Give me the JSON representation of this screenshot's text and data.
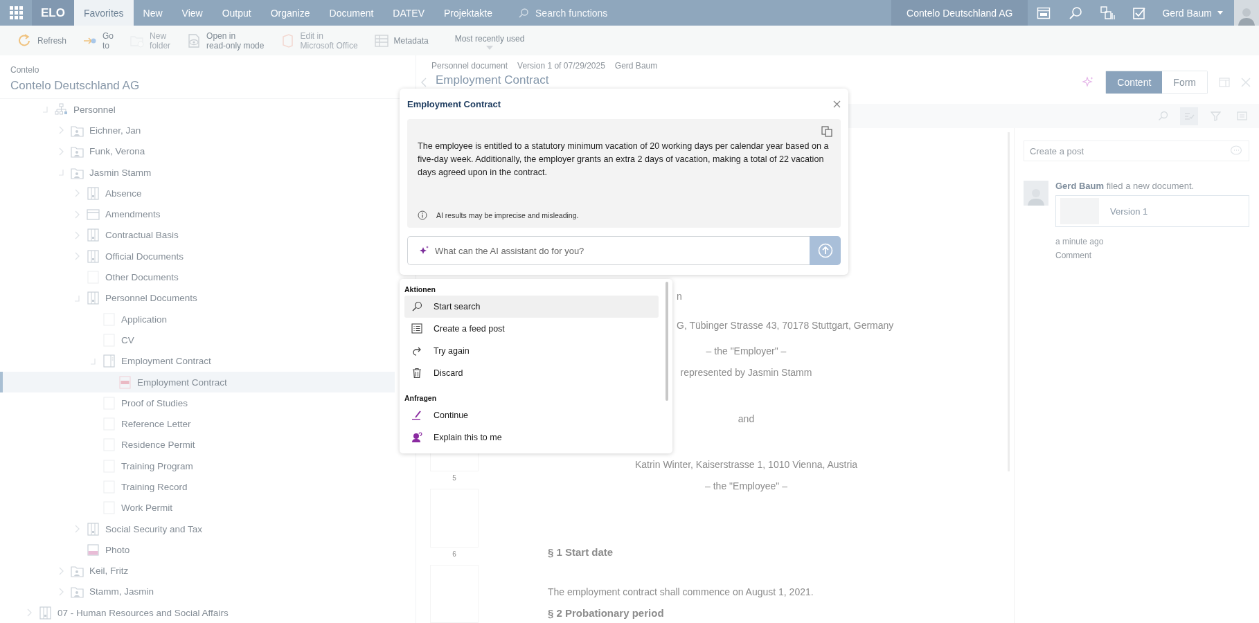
{
  "topbar": {
    "logo": "ELO",
    "tabs": [
      {
        "label": "Favorites",
        "selected": true
      },
      {
        "label": "New",
        "selected": false
      },
      {
        "label": "View",
        "selected": false
      },
      {
        "label": "Output",
        "selected": false
      },
      {
        "label": "Organize",
        "selected": false
      },
      {
        "label": "Document",
        "selected": false
      },
      {
        "label": "DATEV",
        "selected": false
      },
      {
        "label": "Projektakte",
        "selected": false
      }
    ],
    "search": {
      "placeholder": "Search functions"
    },
    "company": "Contelo Deutschland AG",
    "user": "Gerd Baum"
  },
  "toolbar": {
    "buttons": [
      {
        "label": "Refresh",
        "disabled": false
      },
      {
        "label": "Go\nto",
        "disabled": false
      },
      {
        "label": "New\nfolder",
        "disabled": true
      },
      {
        "label": "Open in\nread-only mode",
        "disabled": false
      },
      {
        "label": "Edit in\nMicrosoft Office",
        "disabled": true
      },
      {
        "label": "Metadata",
        "disabled": false
      }
    ],
    "dropdown": "Most recently used"
  },
  "navigation": {
    "breadcrumb": "Contelo",
    "title": "Contelo Deutschland AG",
    "tree": [
      {
        "children": [
          {
            "label": "Personnel",
            "kind": "org",
            "expanded": true,
            "selected": false,
            "children": [
              {
                "label": "Eichner, Jan",
                "kind": "person",
                "expanded": false,
                "selected": false
              },
              {
                "label": "Funk, Verona",
                "kind": "person",
                "expanded": false,
                "selected": false
              },
              {
                "label": "Jasmin Stamm",
                "kind": "person",
                "expanded": true,
                "selected": false,
                "children": [
                  {
                    "label": "Absence",
                    "kind": "register",
                    "expanded": false,
                    "selected": false
                  },
                  {
                    "label": "Amendments",
                    "kind": "calendar",
                    "expanded": false,
                    "selected": false
                  },
                  {
                    "label": "Contractual Basis",
                    "kind": "register",
                    "expanded": false,
                    "selected": false
                  },
                  {
                    "label": "Official Documents",
                    "kind": "register",
                    "expanded": false,
                    "selected": false
                  },
                  {
                    "label": "Other Documents",
                    "kind": "blank",
                    "selected": false
                  },
                  {
                    "label": "Personnel Documents",
                    "kind": "register",
                    "expanded": true,
                    "selected": false,
                    "children": [
                      {
                        "label": "Application",
                        "kind": "blank",
                        "selected": false
                      },
                      {
                        "label": "CV",
                        "kind": "blank",
                        "selected": false
                      },
                      {
                        "label": "Employment Contract",
                        "kind": "doc",
                        "expanded": true,
                        "selected": false,
                        "children": [
                          {
                            "label": "Employment Contract",
                            "kind": "pdf",
                            "selected": true
                          }
                        ]
                      },
                      {
                        "label": "Proof of Studies",
                        "kind": "blank",
                        "selected": false
                      },
                      {
                        "label": "Reference Letter",
                        "kind": "blank",
                        "selected": false
                      },
                      {
                        "label": "Residence Permit",
                        "kind": "blank",
                        "selected": false
                      },
                      {
                        "label": "Training Program",
                        "kind": "blank",
                        "selected": false
                      },
                      {
                        "label": "Training Record",
                        "kind": "blank",
                        "selected": false
                      },
                      {
                        "label": "Work Permit",
                        "kind": "blank",
                        "selected": false
                      }
                    ]
                  },
                  {
                    "label": "Social Security and Tax",
                    "kind": "register",
                    "expanded": false,
                    "selected": false
                  },
                  {
                    "label": "Photo",
                    "kind": "jpg",
                    "selected": false
                  }
                ]
              },
              {
                "label": "Keil, Fritz",
                "kind": "person",
                "expanded": false,
                "selected": false
              },
              {
                "label": "Stamm, Jasmin",
                "kind": "person",
                "expanded": false,
                "selected": false
              }
            ]
          }
        ]
      },
      {
        "label": "07 - Human Resources and Social Affairs",
        "kind": "register",
        "expanded": false,
        "selected": false
      }
    ]
  },
  "document": {
    "type": "Personnel document",
    "version": "Version 1 of 07/29/2025",
    "author": "Gerd Baum",
    "title": "Employment Contract",
    "views": [
      {
        "label": "Content",
        "selected": true
      },
      {
        "label": "Form",
        "selected": false
      }
    ],
    "pages": [
      "5",
      "6"
    ],
    "lines": [
      {
        "kind": "clipped",
        "text": "n"
      },
      {
        "kind": "clipped",
        "text": "G, Tübinger Strasse 43, 70178 Stuttgart, Germany"
      },
      {
        "kind": "center",
        "text": "– the \"Employer\" –"
      },
      {
        "kind": "center",
        "text": "represented by Jasmin Stamm"
      },
      {
        "kind": "spaced",
        "text": "and"
      },
      {
        "kind": "center",
        "text": "Katrin Winter, Kaiserstrasse 1, 1010 Vienna, Austria"
      },
      {
        "kind": "center",
        "text": "– the \"Employee\" –"
      },
      {
        "kind": "heading",
        "text": "§ 1 Start date"
      },
      {
        "kind": "para",
        "text": "The employment contract shall commence on August 1, 2021."
      },
      {
        "kind": "heading",
        "text": "§ 2 Probationary period"
      }
    ]
  },
  "feed": {
    "placeholder": "Create a post",
    "entries": [
      {
        "text": "**Gerd Baum** filed a new document.",
        "attachment": "Version 1",
        "time": "a minute ago",
        "action": "Comment"
      }
    ]
  },
  "ai_dialog": {
    "title": "Employment Contract",
    "response": "The employee is entitled to a statutory minimum vacation of 20 working days per calendar year based on a five-day week. Additionally, the employer grants an extra 2 days of vacation, making a total of 22 vacation days agreed upon in the contract.",
    "disclaimer": "AI results may be imprecise and misleading.",
    "input": {
      "placeholder": "What can the AI assistant do for you?"
    }
  },
  "ai_menu": {
    "sections": [
      {
        "heading": "Aktionen",
        "items": [
          {
            "label": "Start search",
            "selected": true
          },
          {
            "label": "Create a feed post",
            "selected": false
          },
          {
            "label": "Try again",
            "selected": false
          },
          {
            "label": "Discard",
            "selected": false
          }
        ]
      },
      {
        "heading": "Anfragen",
        "items": [
          {
            "label": "Continue",
            "selected": false
          },
          {
            "label": "Explain this to me",
            "selected": false
          }
        ]
      }
    ]
  }
}
